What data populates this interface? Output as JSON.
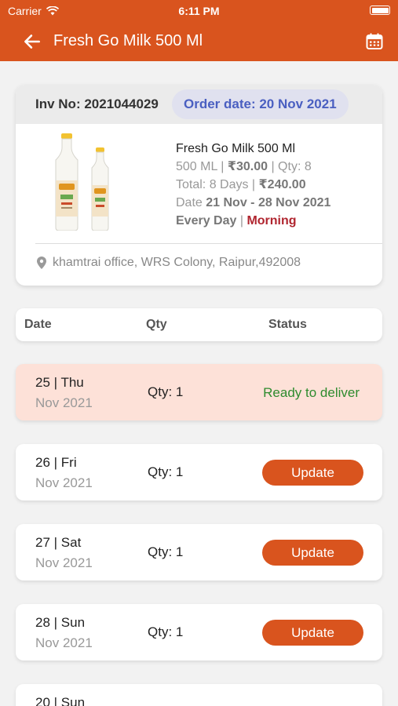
{
  "status_bar": {
    "carrier": "Carrier",
    "time": "6:11 PM"
  },
  "nav": {
    "title": "Fresh Go Milk 500 Ml",
    "back_icon": "arrow-left-icon",
    "calendar_icon": "calendar-icon"
  },
  "invoice": {
    "inv_no": "Inv No: 2021044029",
    "order_date": "Order date: 20 Nov 2021",
    "product_name": "Fresh Go Milk 500 Ml",
    "size": "500 ML",
    "price": "₹30.00",
    "qty": "Qty: 8",
    "total_label": "Total: 8 Days",
    "total_amount": "₹240.00",
    "date_label": "Date",
    "date_range": "21 Nov - 28 Nov 2021",
    "frequency": "Every Day",
    "slot": "Morning",
    "address": "khamtrai office, WRS Colony, Raipur,492008"
  },
  "table": {
    "col_date": "Date",
    "col_qty": "Qty",
    "col_status": "Status"
  },
  "rows": [
    {
      "date": "25 | Thu",
      "month": "Nov 2021",
      "qty": "Qty: 1",
      "status": "Ready to deliver"
    },
    {
      "date": "26 | Fri",
      "month": "Nov 2021",
      "qty": "Qty: 1",
      "button": "Update"
    },
    {
      "date": "27 | Sat",
      "month": "Nov 2021",
      "qty": "Qty: 1",
      "button": "Update"
    },
    {
      "date": "28 | Sun",
      "month": "Nov 2021",
      "qty": "Qty: 1",
      "button": "Update"
    },
    {
      "date": "20 | Sun"
    }
  ],
  "colors": {
    "brand": "#d9541e",
    "ready": "#2e8b2e",
    "morning": "#b0252f",
    "order_date": "#4a5fc1"
  }
}
